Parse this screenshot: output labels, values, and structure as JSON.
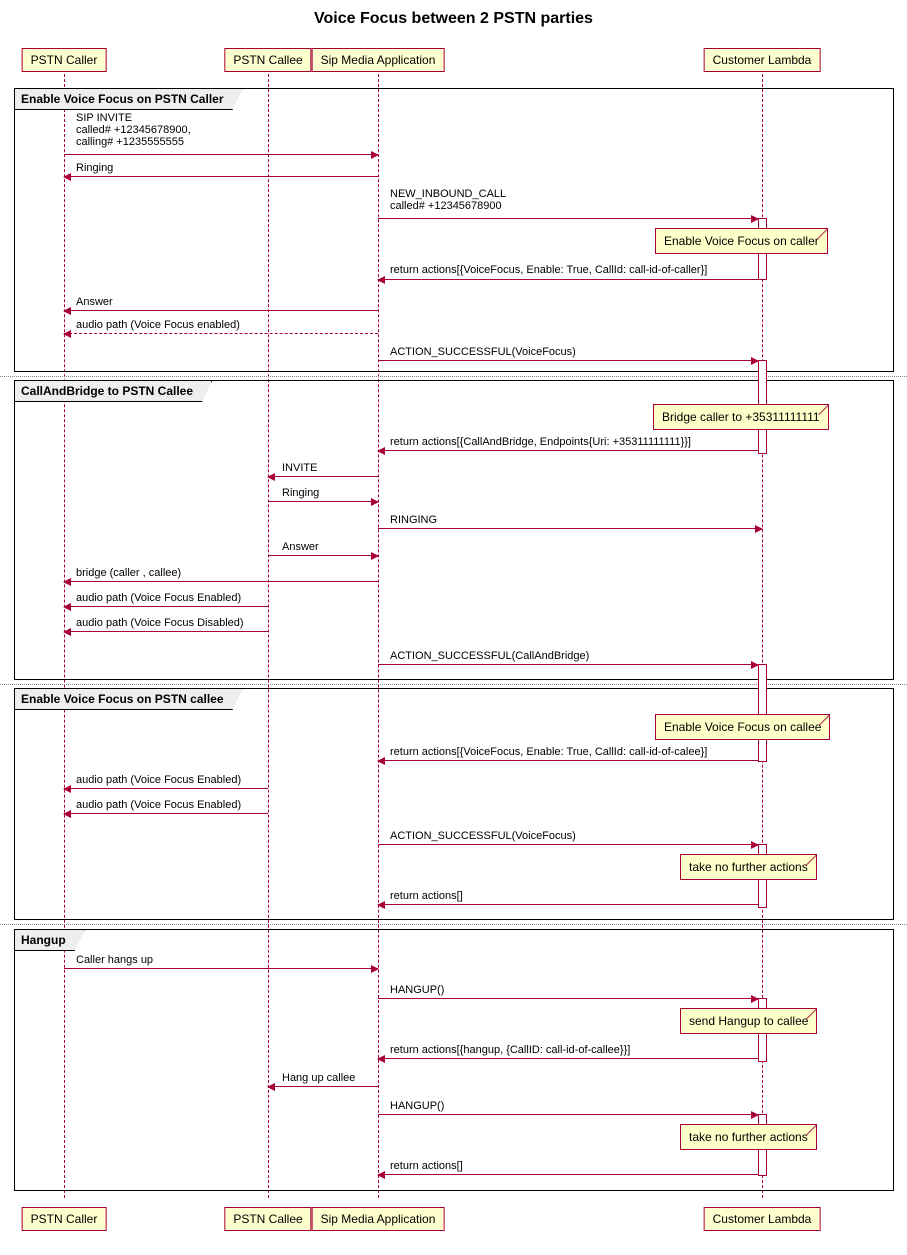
{
  "title": "Voice Focus between 2 PSTN parties",
  "participants": {
    "caller": "PSTN Caller",
    "callee": "PSTN Callee",
    "sma": "Sip Media Application",
    "lambda": "Customer Lambda"
  },
  "groups": {
    "g1": "Enable Voice Focus on PSTN Caller",
    "g2": "CallAndBridge to PSTN Callee",
    "g3": "Enable Voice Focus on PSTN callee",
    "g4": "Hangup"
  },
  "notes": {
    "n1": "Enable Voice Focus on caller",
    "n2": "Bridge caller to +35311111111",
    "n3": "Enable Voice Focus on callee",
    "n4": "take no further actions",
    "n5": "send Hangup to callee",
    "n6": "take no further actions"
  },
  "messages": {
    "m1": "SIP INVITE\ncalled# +12345678900,\ncalling# +1235555555",
    "m2": "Ringing",
    "m3": "NEW_INBOUND_CALL\ncalled# +12345678900",
    "m4": "return actions[{VoiceFocus, Enable: True, CallId: call-id-of-caller}]",
    "m5": "Answer",
    "m6": "audio path (Voice Focus enabled)",
    "m7": "ACTION_SUCCESSFUL(VoiceFocus)",
    "m8": "return actions[{CallAndBridge, Endpoints{Uri: +35311111111}}]",
    "m9": "INVITE",
    "m10": "Ringing",
    "m11": "RINGING",
    "m12": "Answer",
    "m13": "bridge (caller , callee)",
    "m14": "audio path (Voice Focus Enabled)",
    "m15": "audio path (Voice Focus Disabled)",
    "m16": "ACTION_SUCCESSFUL(CallAndBridge)",
    "m17": "return actions[{VoiceFocus, Enable: True, CallId: call-id-of-calee}]",
    "m18": "audio path (Voice Focus Enabled)",
    "m19": "audio path (Voice Focus Enabled)",
    "m20": "ACTION_SUCCESSFUL(VoiceFocus)",
    "m21": "return actions[]",
    "m22": "Caller hangs up",
    "m23": "HANGUP()",
    "m24": "return actions[{hangup, {CallID: call-id-of-callee}}]",
    "m25": "Hang up callee",
    "m26": "HANGUP()",
    "m27": "return actions[]"
  }
}
